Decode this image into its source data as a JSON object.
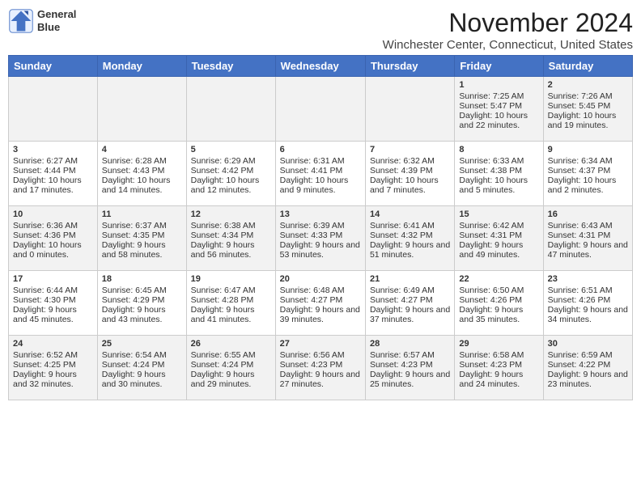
{
  "logo": {
    "line1": "General",
    "line2": "Blue"
  },
  "title": "November 2024",
  "location": "Winchester Center, Connecticut, United States",
  "days_of_week": [
    "Sunday",
    "Monday",
    "Tuesday",
    "Wednesday",
    "Thursday",
    "Friday",
    "Saturday"
  ],
  "weeks": [
    [
      {
        "day": "",
        "content": ""
      },
      {
        "day": "",
        "content": ""
      },
      {
        "day": "",
        "content": ""
      },
      {
        "day": "",
        "content": ""
      },
      {
        "day": "",
        "content": ""
      },
      {
        "day": "1",
        "content": "Sunrise: 7:25 AM\nSunset: 5:47 PM\nDaylight: 10 hours and 22 minutes."
      },
      {
        "day": "2",
        "content": "Sunrise: 7:26 AM\nSunset: 5:45 PM\nDaylight: 10 hours and 19 minutes."
      }
    ],
    [
      {
        "day": "3",
        "content": "Sunrise: 6:27 AM\nSunset: 4:44 PM\nDaylight: 10 hours and 17 minutes."
      },
      {
        "day": "4",
        "content": "Sunrise: 6:28 AM\nSunset: 4:43 PM\nDaylight: 10 hours and 14 minutes."
      },
      {
        "day": "5",
        "content": "Sunrise: 6:29 AM\nSunset: 4:42 PM\nDaylight: 10 hours and 12 minutes."
      },
      {
        "day": "6",
        "content": "Sunrise: 6:31 AM\nSunset: 4:41 PM\nDaylight: 10 hours and 9 minutes."
      },
      {
        "day": "7",
        "content": "Sunrise: 6:32 AM\nSunset: 4:39 PM\nDaylight: 10 hours and 7 minutes."
      },
      {
        "day": "8",
        "content": "Sunrise: 6:33 AM\nSunset: 4:38 PM\nDaylight: 10 hours and 5 minutes."
      },
      {
        "day": "9",
        "content": "Sunrise: 6:34 AM\nSunset: 4:37 PM\nDaylight: 10 hours and 2 minutes."
      }
    ],
    [
      {
        "day": "10",
        "content": "Sunrise: 6:36 AM\nSunset: 4:36 PM\nDaylight: 10 hours and 0 minutes."
      },
      {
        "day": "11",
        "content": "Sunrise: 6:37 AM\nSunset: 4:35 PM\nDaylight: 9 hours and 58 minutes."
      },
      {
        "day": "12",
        "content": "Sunrise: 6:38 AM\nSunset: 4:34 PM\nDaylight: 9 hours and 56 minutes."
      },
      {
        "day": "13",
        "content": "Sunrise: 6:39 AM\nSunset: 4:33 PM\nDaylight: 9 hours and 53 minutes."
      },
      {
        "day": "14",
        "content": "Sunrise: 6:41 AM\nSunset: 4:32 PM\nDaylight: 9 hours and 51 minutes."
      },
      {
        "day": "15",
        "content": "Sunrise: 6:42 AM\nSunset: 4:31 PM\nDaylight: 9 hours and 49 minutes."
      },
      {
        "day": "16",
        "content": "Sunrise: 6:43 AM\nSunset: 4:31 PM\nDaylight: 9 hours and 47 minutes."
      }
    ],
    [
      {
        "day": "17",
        "content": "Sunrise: 6:44 AM\nSunset: 4:30 PM\nDaylight: 9 hours and 45 minutes."
      },
      {
        "day": "18",
        "content": "Sunrise: 6:45 AM\nSunset: 4:29 PM\nDaylight: 9 hours and 43 minutes."
      },
      {
        "day": "19",
        "content": "Sunrise: 6:47 AM\nSunset: 4:28 PM\nDaylight: 9 hours and 41 minutes."
      },
      {
        "day": "20",
        "content": "Sunrise: 6:48 AM\nSunset: 4:27 PM\nDaylight: 9 hours and 39 minutes."
      },
      {
        "day": "21",
        "content": "Sunrise: 6:49 AM\nSunset: 4:27 PM\nDaylight: 9 hours and 37 minutes."
      },
      {
        "day": "22",
        "content": "Sunrise: 6:50 AM\nSunset: 4:26 PM\nDaylight: 9 hours and 35 minutes."
      },
      {
        "day": "23",
        "content": "Sunrise: 6:51 AM\nSunset: 4:26 PM\nDaylight: 9 hours and 34 minutes."
      }
    ],
    [
      {
        "day": "24",
        "content": "Sunrise: 6:52 AM\nSunset: 4:25 PM\nDaylight: 9 hours and 32 minutes."
      },
      {
        "day": "25",
        "content": "Sunrise: 6:54 AM\nSunset: 4:24 PM\nDaylight: 9 hours and 30 minutes."
      },
      {
        "day": "26",
        "content": "Sunrise: 6:55 AM\nSunset: 4:24 PM\nDaylight: 9 hours and 29 minutes."
      },
      {
        "day": "27",
        "content": "Sunrise: 6:56 AM\nSunset: 4:23 PM\nDaylight: 9 hours and 27 minutes."
      },
      {
        "day": "28",
        "content": "Sunrise: 6:57 AM\nSunset: 4:23 PM\nDaylight: 9 hours and 25 minutes."
      },
      {
        "day": "29",
        "content": "Sunrise: 6:58 AM\nSunset: 4:23 PM\nDaylight: 9 hours and 24 minutes."
      },
      {
        "day": "30",
        "content": "Sunrise: 6:59 AM\nSunset: 4:22 PM\nDaylight: 9 hours and 23 minutes."
      }
    ]
  ]
}
